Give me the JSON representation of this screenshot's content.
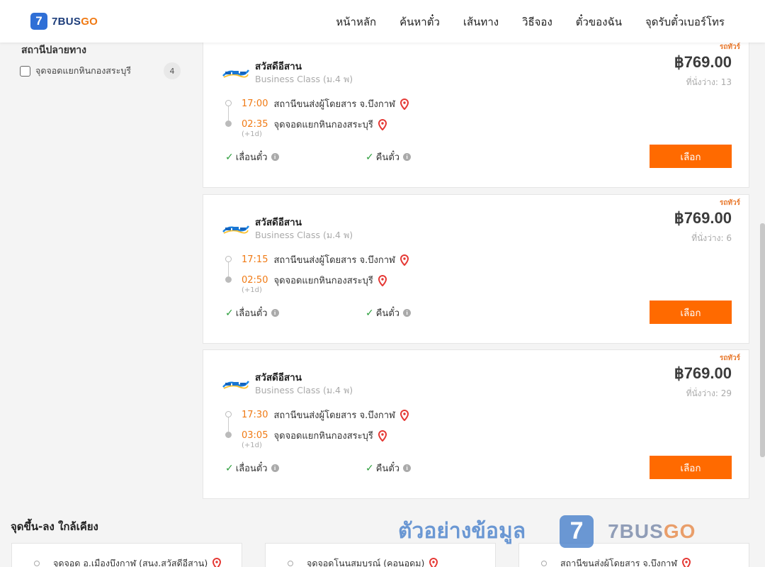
{
  "brand": {
    "mark": "7",
    "name_main": "7BUS",
    "name_accent": "GO"
  },
  "nav": [
    "หน้าหลัก",
    "ค้นหาตั๋ว",
    "เส้นทาง",
    "วิธีจอง",
    "ตั๋วของฉัน",
    "จุดรับตั๋วเบอร์โทร"
  ],
  "sidebar": {
    "title": "สถานีปลายทาง",
    "filter": {
      "label": "จุดจอดแยกหินกองสระบุรี",
      "count": "4"
    }
  },
  "trips": [
    {
      "badge": "รถทัวร์",
      "operator": "สวัสดีอีสาน",
      "bus_class": "Business Class (ม.4 พ)",
      "price": "฿769.00",
      "seats": "ที่นั่งว่าง: 13",
      "depart_time": "17:00",
      "depart_place": "สถานีขนส่งผู้โดยสาร จ.บึงกาฬ",
      "arrive_time": "02:35",
      "arrive_place": "จุดจอดแยกหินกองสระบุรี",
      "next_day": "(+1d)",
      "feature1": "เลื่อนตั๋ว",
      "feature2": "คืนตั๋ว",
      "button": "เลือก"
    },
    {
      "badge": "รถทัวร์",
      "operator": "สวัสดีอีสาน",
      "bus_class": "Business Class (ม.4 พ)",
      "price": "฿769.00",
      "seats": "ที่นั่งว่าง: 6",
      "depart_time": "17:15",
      "depart_place": "สถานีขนส่งผู้โดยสาร จ.บึงกาฬ",
      "arrive_time": "02:50",
      "arrive_place": "จุดจอดแยกหินกองสระบุรี",
      "next_day": "(+1d)",
      "feature1": "เลื่อนตั๋ว",
      "feature2": "คืนตั๋ว",
      "button": "เลือก"
    },
    {
      "badge": "รถทัวร์",
      "operator": "สวัสดีอีสาน",
      "bus_class": "Business Class (ม.4 พ)",
      "price": "฿769.00",
      "seats": "ที่นั่งว่าง: 29",
      "depart_time": "17:30",
      "depart_place": "สถานีขนส่งผู้โดยสาร จ.บึงกาฬ",
      "arrive_time": "03:05",
      "arrive_place": "จุดจอดแยกหินกองสระบุรี",
      "next_day": "(+1d)",
      "feature1": "เลื่อนตั๋ว",
      "feature2": "คืนตั๋ว",
      "button": "เลือก"
    }
  ],
  "nearby": {
    "title": "จุดขึ้น-ลง ใกล้เคียง",
    "stops": [
      "จุดจอด อ.เมืองบึงกาฬ (สนง.สวัสดีอีสาน)",
      "จุดจอดโนนสมบูรณ์ (คอนอุดม)",
      "สถานีขนส่งผู้โดยสาร จ.บึงกาฬ"
    ]
  },
  "watermark": {
    "text": "ตัวอย่างข้อมูล",
    "mark": "7",
    "brand_main": "7BUS",
    "brand_accent": "GO"
  },
  "colors": {
    "accent": "#ff6a00",
    "time": "#f07a14",
    "check": "#2a9d3a",
    "pin": "#e53935",
    "brand_blue": "#2f6fd6"
  }
}
